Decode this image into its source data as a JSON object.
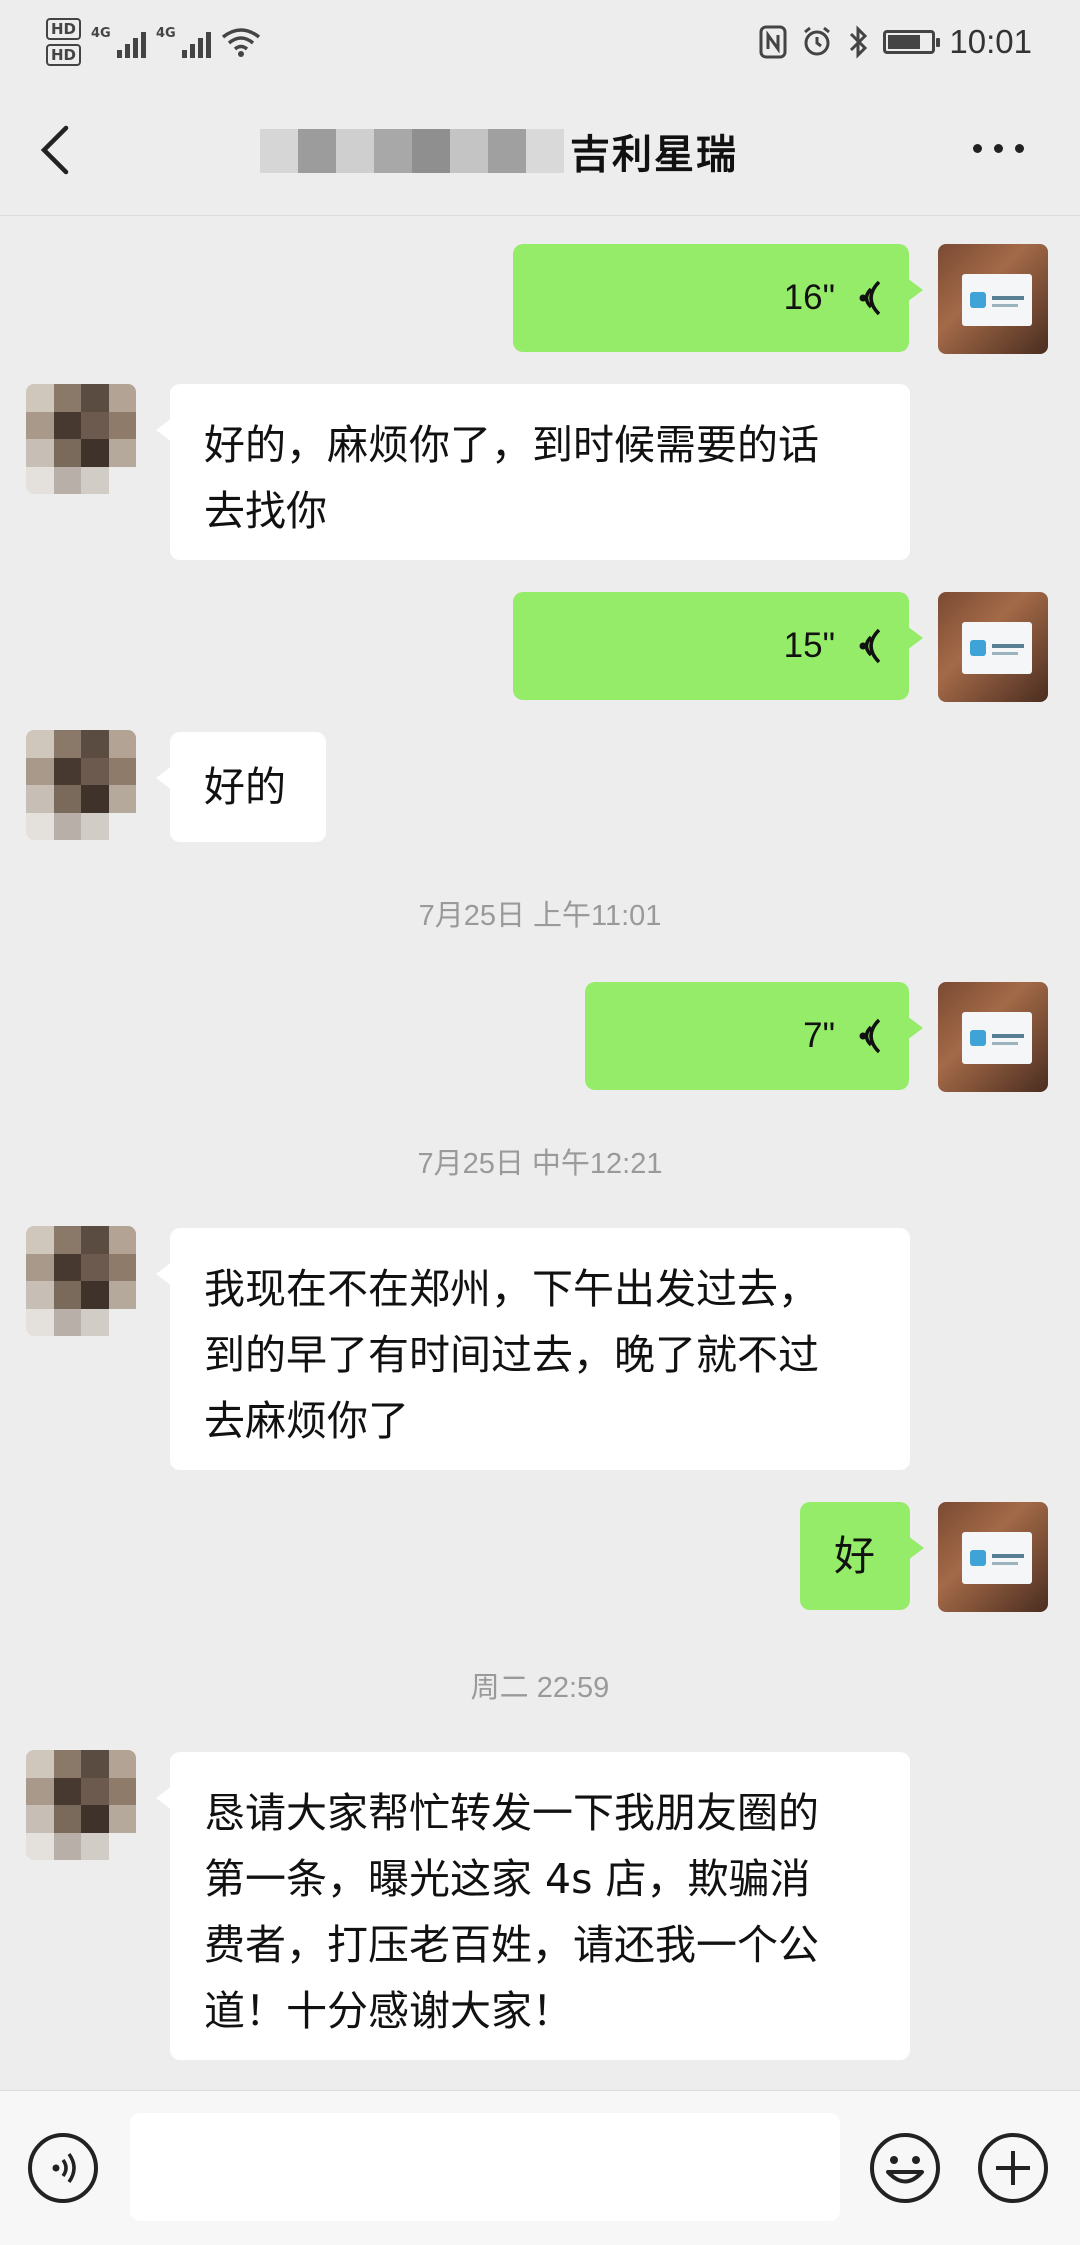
{
  "status_bar": {
    "hd1": "HD",
    "hd2": "HD",
    "net1": "4G",
    "net2": "4G",
    "time": "10:01"
  },
  "header": {
    "title": "吉利星瑞"
  },
  "messages": [
    {
      "sender": "me",
      "type": "voice",
      "duration": "16\""
    },
    {
      "sender": "other",
      "type": "text",
      "lines": [
        "好的，麻烦你了，到时候需要的话",
        "去找你"
      ]
    },
    {
      "sender": "me",
      "type": "voice",
      "duration": "15\""
    },
    {
      "sender": "other",
      "type": "text",
      "lines": [
        "好的"
      ]
    },
    {
      "type": "timestamp",
      "text": "7月25日 上午11:01"
    },
    {
      "sender": "me",
      "type": "voice",
      "duration": "7\""
    },
    {
      "type": "timestamp",
      "text": "7月25日 中午12:21"
    },
    {
      "sender": "other",
      "type": "text",
      "lines": [
        "我现在不在郑州，下午出发过去，",
        "到的早了有时间过去，晚了就不过",
        "去麻烦你了"
      ]
    },
    {
      "sender": "me",
      "type": "text",
      "lines": [
        "好"
      ]
    },
    {
      "type": "timestamp",
      "text": "周二 22:59"
    },
    {
      "sender": "other",
      "type": "text",
      "lines": [
        "恳请大家帮忙转发一下我朋友圈的",
        "第一条，曝光这家 4s 店，欺骗消",
        "费者，打压老百姓，请还我一个公",
        "道！十分感谢大家！"
      ]
    }
  ],
  "input_bar": {
    "voice_icon": "voice-input-icon",
    "emoji_icon": "emoji-icon",
    "plus_icon": "plus-icon"
  },
  "colors": {
    "background": "#ededed",
    "my_bubble": "#95ec69",
    "other_bubble": "#ffffff"
  }
}
